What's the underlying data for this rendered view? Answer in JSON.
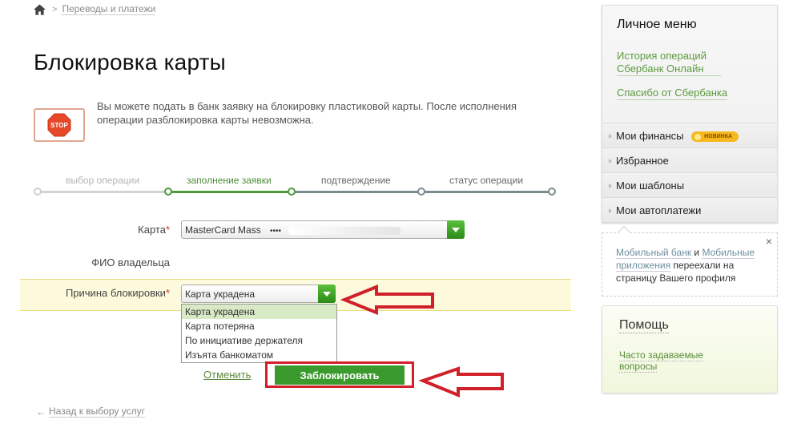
{
  "breadcrumb": {
    "home_icon": "home-icon",
    "separator": ">",
    "items": [
      "Переводы и платежи"
    ]
  },
  "page": {
    "title": "Блокировка карты",
    "stop_icon_label": "STOP",
    "notice": "Вы можете подать в банк заявку на блокировку пластиковой карты. После исполнения операции разблокировка карты невозможна."
  },
  "steps": [
    {
      "label": "выбор операции",
      "state": "done"
    },
    {
      "label": "заполнение заявки",
      "state": "current"
    },
    {
      "label": "подтверждение",
      "state": "pending"
    },
    {
      "label": "статус операции",
      "state": "pending"
    }
  ],
  "form": {
    "card_label": "Карта",
    "card_value": "MasterCard Mass",
    "card_masked": "••••",
    "owner_label": "ФИО владельца",
    "owner_value": "",
    "reason_label": "Причина блокировки",
    "required_mark": "*",
    "reason_selected": "Карта украдена",
    "reason_options": [
      "Карта украдена",
      "Карта потеряна",
      "По инициативе держателя",
      "Изъята банкоматом"
    ],
    "cancel_label": "Отменить",
    "submit_label": "Заблокировать"
  },
  "back_link": {
    "arrow": "←",
    "label": "Назад к выбору услуг"
  },
  "sidebar": {
    "title": "Личное меню",
    "links": [
      "История операций Сбербанк Онлайн",
      "Спасибо от Сбербанка"
    ],
    "menu": [
      {
        "label": "Мои финансы",
        "badge": "НОВИНКА"
      },
      {
        "label": "Избранное"
      },
      {
        "label": "Мои шаблоны"
      },
      {
        "label": "Мои автоплатежи"
      }
    ],
    "notice": {
      "link1": "Мобильный банк",
      "and": " и ",
      "link2": "Мобильные приложения",
      "rest": " переехали на страницу Вашего профиля",
      "close": "×"
    },
    "help": {
      "title": "Помощь",
      "faq": "Часто задаваемые вопросы"
    }
  },
  "colors": {
    "accent_green": "#3b9a2e",
    "link_green": "#5c9a3e",
    "annotation_red": "#d0202a",
    "highlight_yellow": "#fcf9dc",
    "badge_orange": "#f6b81e"
  }
}
